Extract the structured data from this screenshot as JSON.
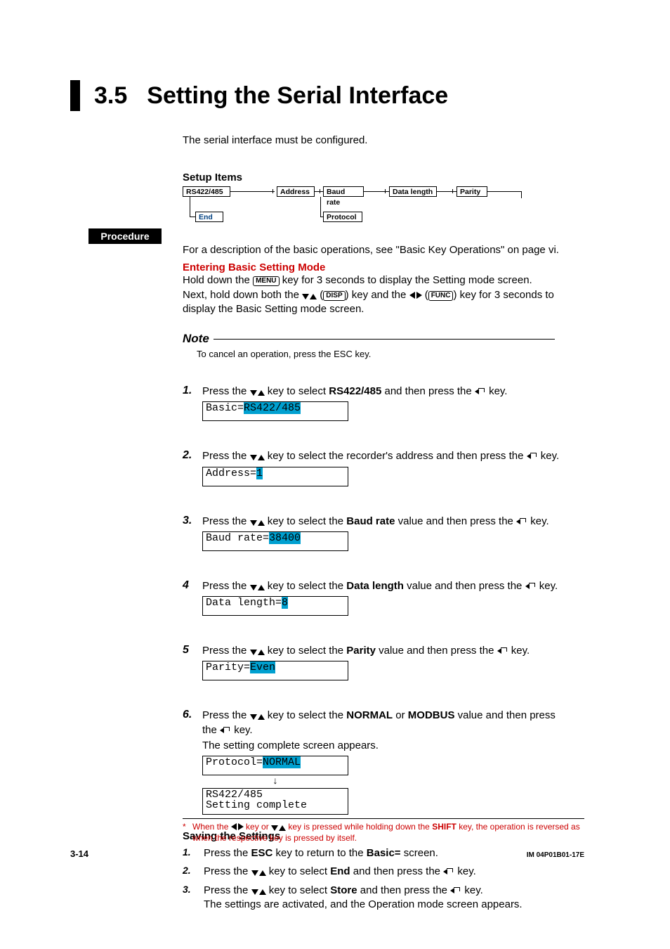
{
  "section_number": "3.5",
  "section_title": "Setting the Serial Interface",
  "intro": "The serial interface must be configured.",
  "setup_items_label": "Setup Items",
  "setup_boxes": {
    "rs": "RS422/485",
    "address": "Address",
    "baud": "Baud rate",
    "datalen": "Data length",
    "parity": "Parity",
    "end": "End",
    "protocol": "Protocol"
  },
  "procedure_label": "Procedure",
  "proc_intro": "For a description of the basic operations, see \"Basic Key Operations\" on page vi.",
  "enter_heading": "Entering Basic Setting Mode",
  "enter_line1_a": "Hold down the ",
  "key_menu": "MENU",
  "enter_line1_b": " key for 3 seconds to display the Setting mode screen.",
  "enter_line2_a": "Next, hold down both the ",
  "key_disp": "DISP",
  "enter_line2_b": ") key and the ",
  "key_func": "FUNC",
  "enter_line2_c": ") key for 3 seconds to display the Basic Setting mode screen.",
  "note_title": "Note",
  "note_text": "To cancel an operation, press the ESC key.",
  "steps": [
    {
      "n": "1.",
      "pre": "Press the ",
      "mid": " key to select ",
      "bold": "RS422/485",
      "post": " and then press the ",
      "end": " key.",
      "lcd_pre": "Basic=",
      "lcd_hl": "RS422/485"
    },
    {
      "n": "2.",
      "pre": "Press the ",
      "mid": " key to select the recorder's address and then press the ",
      "end": " key.",
      "lcd_pre": "Address=",
      "lcd_hl": "1"
    },
    {
      "n": "3.",
      "pre": "Press the ",
      "mid": " key to select the ",
      "bold": "Baud rate",
      "post": " value and then press the ",
      "end": " key.",
      "lcd_pre": "Baud rate=",
      "lcd_hl": "38400"
    },
    {
      "n": "4",
      "pre": "Press the ",
      "mid": " key to select the ",
      "bold": "Data length",
      "post": " value and then press the ",
      "end": " key.",
      "lcd_pre": "Data length=",
      "lcd_hl": "8"
    },
    {
      "n": "5",
      "pre": "Press the ",
      "mid": " key to select the ",
      "bold": "Parity",
      "post": " value and then press the ",
      "end": " key.",
      "lcd_pre": "Parity=",
      "lcd_hl": "Even"
    }
  ],
  "step6": {
    "n": "6.",
    "pre": "Press the ",
    "mid": " key to select the ",
    "bold1": "NORMAL",
    "or": " or ",
    "bold2": "MODBUS",
    "post": " value and then press the ",
    "end": " key.",
    "after": "The setting complete screen appears.",
    "lcd1_pre": "Protocol=",
    "lcd1_hl": "NORMAL",
    "lcd2_line1": "RS422/485",
    "lcd2_line2": "Setting complete"
  },
  "saving_heading": "Saving the Settings",
  "save_steps": {
    "s1": {
      "n": "1.",
      "a": "Press the ",
      "b": "ESC",
      "c": " key to return to the ",
      "d": "Basic=",
      "e": " screen."
    },
    "s2": {
      "n": "2.",
      "a": "Press the ",
      "b": " key to select ",
      "c": "End",
      "d": " and then press the ",
      "e": " key."
    },
    "s3": {
      "n": "3.",
      "a": "Press the ",
      "b": " key to select ",
      "c": "Store",
      "d": " and then press the ",
      "e": " key.",
      "f": "The settings are activated, and the Operation mode screen appears."
    }
  },
  "footnote_star": "*",
  "footnote_a": "When the ",
  "footnote_b": " key or ",
  "footnote_c": " key is pressed while holding down the ",
  "footnote_bold": "SHIFT",
  "footnote_d": " key, the operation is reversed as when the respective key is pressed by itself.",
  "page_number": "3-14",
  "doc_id": "IM 04P01B01-17E"
}
